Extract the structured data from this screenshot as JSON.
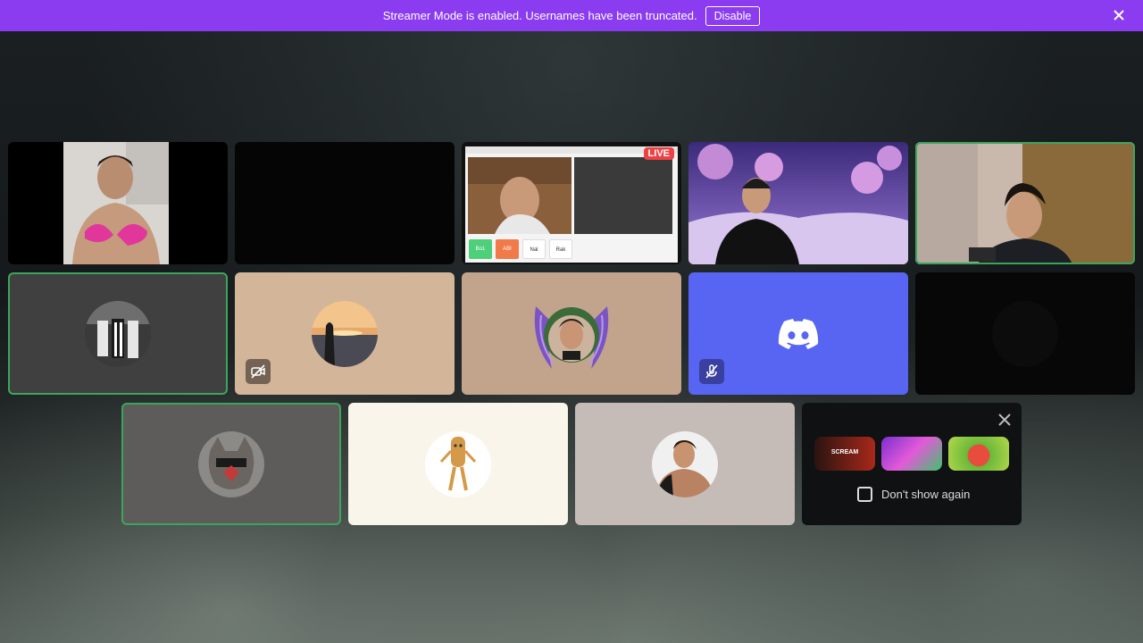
{
  "banner": {
    "message": "Streamer Mode is enabled. Usernames have been truncated.",
    "disable_label": "Disable",
    "close_icon": "close-icon",
    "color": "#8b3cf0"
  },
  "tiles": {
    "stream_live_badge": "LIVE",
    "stream_bottom_buttons": [
      "Bo1",
      "ABI",
      "Nal",
      "Rak"
    ]
  },
  "promo": {
    "cards": [
      "SCREAM",
      "",
      ""
    ],
    "dont_show_label": "Don't show again",
    "close_icon": "close-icon"
  },
  "colors": {
    "speaking_outline": "#3ba55c",
    "discord_blurple": "#5865f2",
    "live_red": "#ed4245"
  }
}
